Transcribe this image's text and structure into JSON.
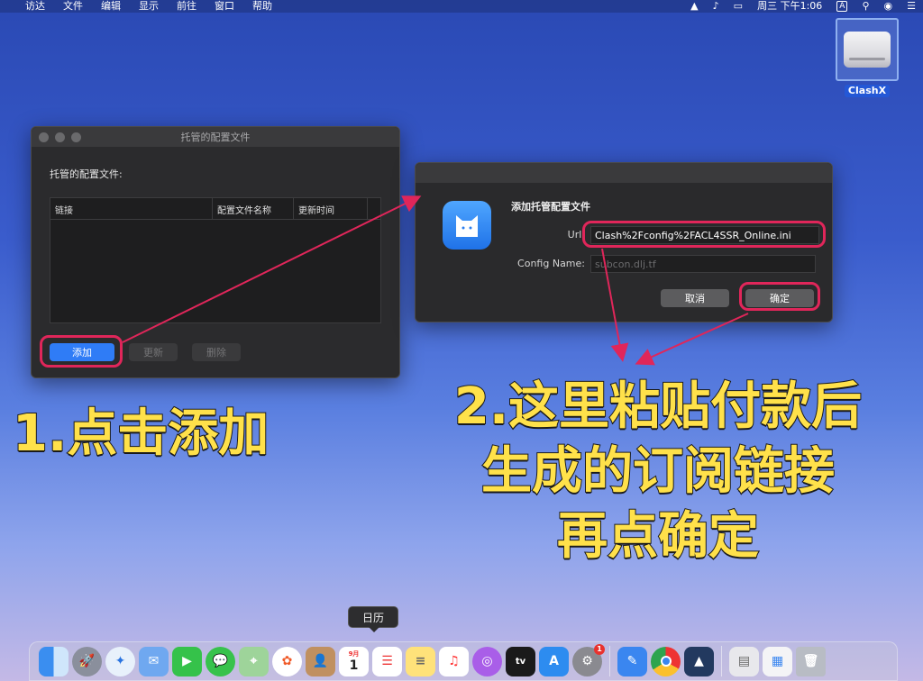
{
  "menubar": {
    "app_items": [
      "访达",
      "文件",
      "编辑",
      "显示",
      "前往",
      "窗口",
      "帮助"
    ],
    "clock": "周三 下午1:06",
    "input_badge": "A"
  },
  "desktop": {
    "drive_label": "ClashX"
  },
  "profiles_window": {
    "title": "托管的配置文件",
    "heading": "托管的配置文件:",
    "columns": [
      "链接",
      "配置文件名称",
      "更新时间"
    ],
    "add_label": "添加",
    "update_label": "更新",
    "delete_label": "删除"
  },
  "add_dialog": {
    "title": "添加托管配置文件",
    "url_label": "Url:",
    "url_value": "Clash%2Fconfig%2FACL4SSR_Online.ini",
    "config_name_label": "Config Name:",
    "config_name_placeholder": "subcon.dlj.tf",
    "cancel_label": "取消",
    "ok_label": "确定"
  },
  "annotations": {
    "step1": "1.点击添加",
    "step2_line1": "2.这里粘贴付款后",
    "step2_line2": "生成的订阅链接",
    "step2_line3": "再点确定",
    "highlight_color": "#e0265a",
    "text_color": "#ffe14a"
  },
  "dock": {
    "tooltip": "日历",
    "calendar_month": "9月",
    "calendar_day": "1",
    "settings_badge": "1",
    "apps": [
      "finder-icon",
      "launchpad-icon",
      "safari-icon",
      "mail-icon",
      "facetime-icon",
      "messages-icon",
      "maps-icon",
      "photos-icon",
      "contacts-icon",
      "calendar-icon",
      "reminders-icon",
      "notes-icon",
      "music-icon",
      "podcasts-icon",
      "tv-icon",
      "app-store-icon",
      "system-preferences-icon",
      "pencil-app-icon",
      "chrome-icon",
      "clashx-icon",
      "downloads-stack-icon",
      "documents-stack-icon",
      "trash-icon"
    ]
  }
}
